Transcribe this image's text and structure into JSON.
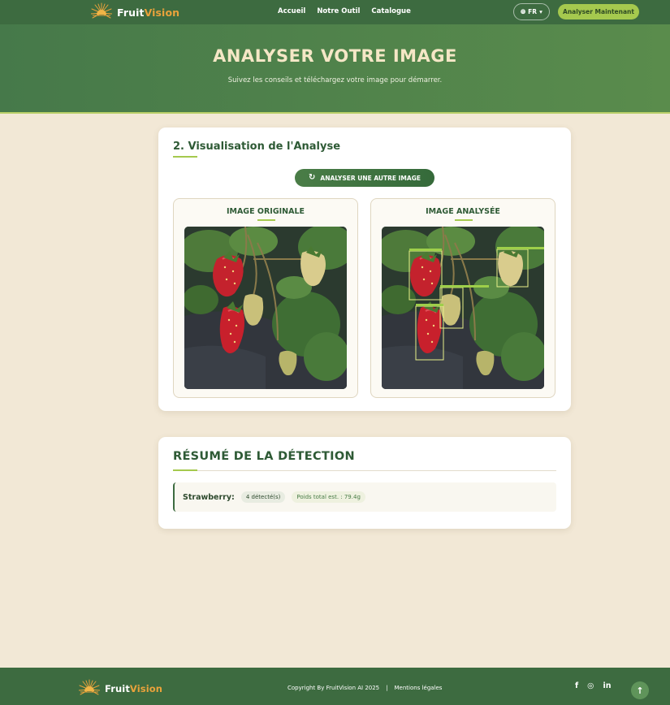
{
  "brand": {
    "name_part1": "Fruit",
    "name_part2": "Vision"
  },
  "nav": {
    "links": [
      "Accueil",
      "Notre Outil",
      "Catalogue"
    ],
    "lang": "FR",
    "cta": "Analyser Maintenant"
  },
  "hero": {
    "title": "ANALYSER VOTRE IMAGE",
    "subtitle": "Suivez les conseils et téléchargez votre image pour démarrer."
  },
  "analysis": {
    "title": "2. Visualisation de l'Analyse",
    "retry_label": "ANALYSER UNE AUTRE IMAGE",
    "original_label": "IMAGE ORIGINALE",
    "analyzed_label": "IMAGE ANALYSÉE"
  },
  "summary": {
    "title": "RÉSUMÉ DE LA DÉTECTION",
    "results": [
      {
        "fruit": "Strawberry:",
        "count": "4 détecté(s)",
        "weight": "Poids total est. : 79.4g"
      }
    ]
  },
  "footer": {
    "copyright": "Copyright By FruitVision AI 2025",
    "legal": "Mentions légales"
  },
  "icons": {
    "logo": "sun-logo-icon",
    "lang": "globe-icon",
    "retry": "refresh-icon",
    "social": [
      "facebook-icon",
      "instagram-icon",
      "linkedin-icon"
    ],
    "to_top": "arrow-up-icon"
  },
  "colors": {
    "primary": "#3d6b40",
    "accent_green": "#a5c94e",
    "brand_orange": "#e9a23b",
    "background": "#f2e8d6",
    "hero_title": "#f5e7c6"
  }
}
